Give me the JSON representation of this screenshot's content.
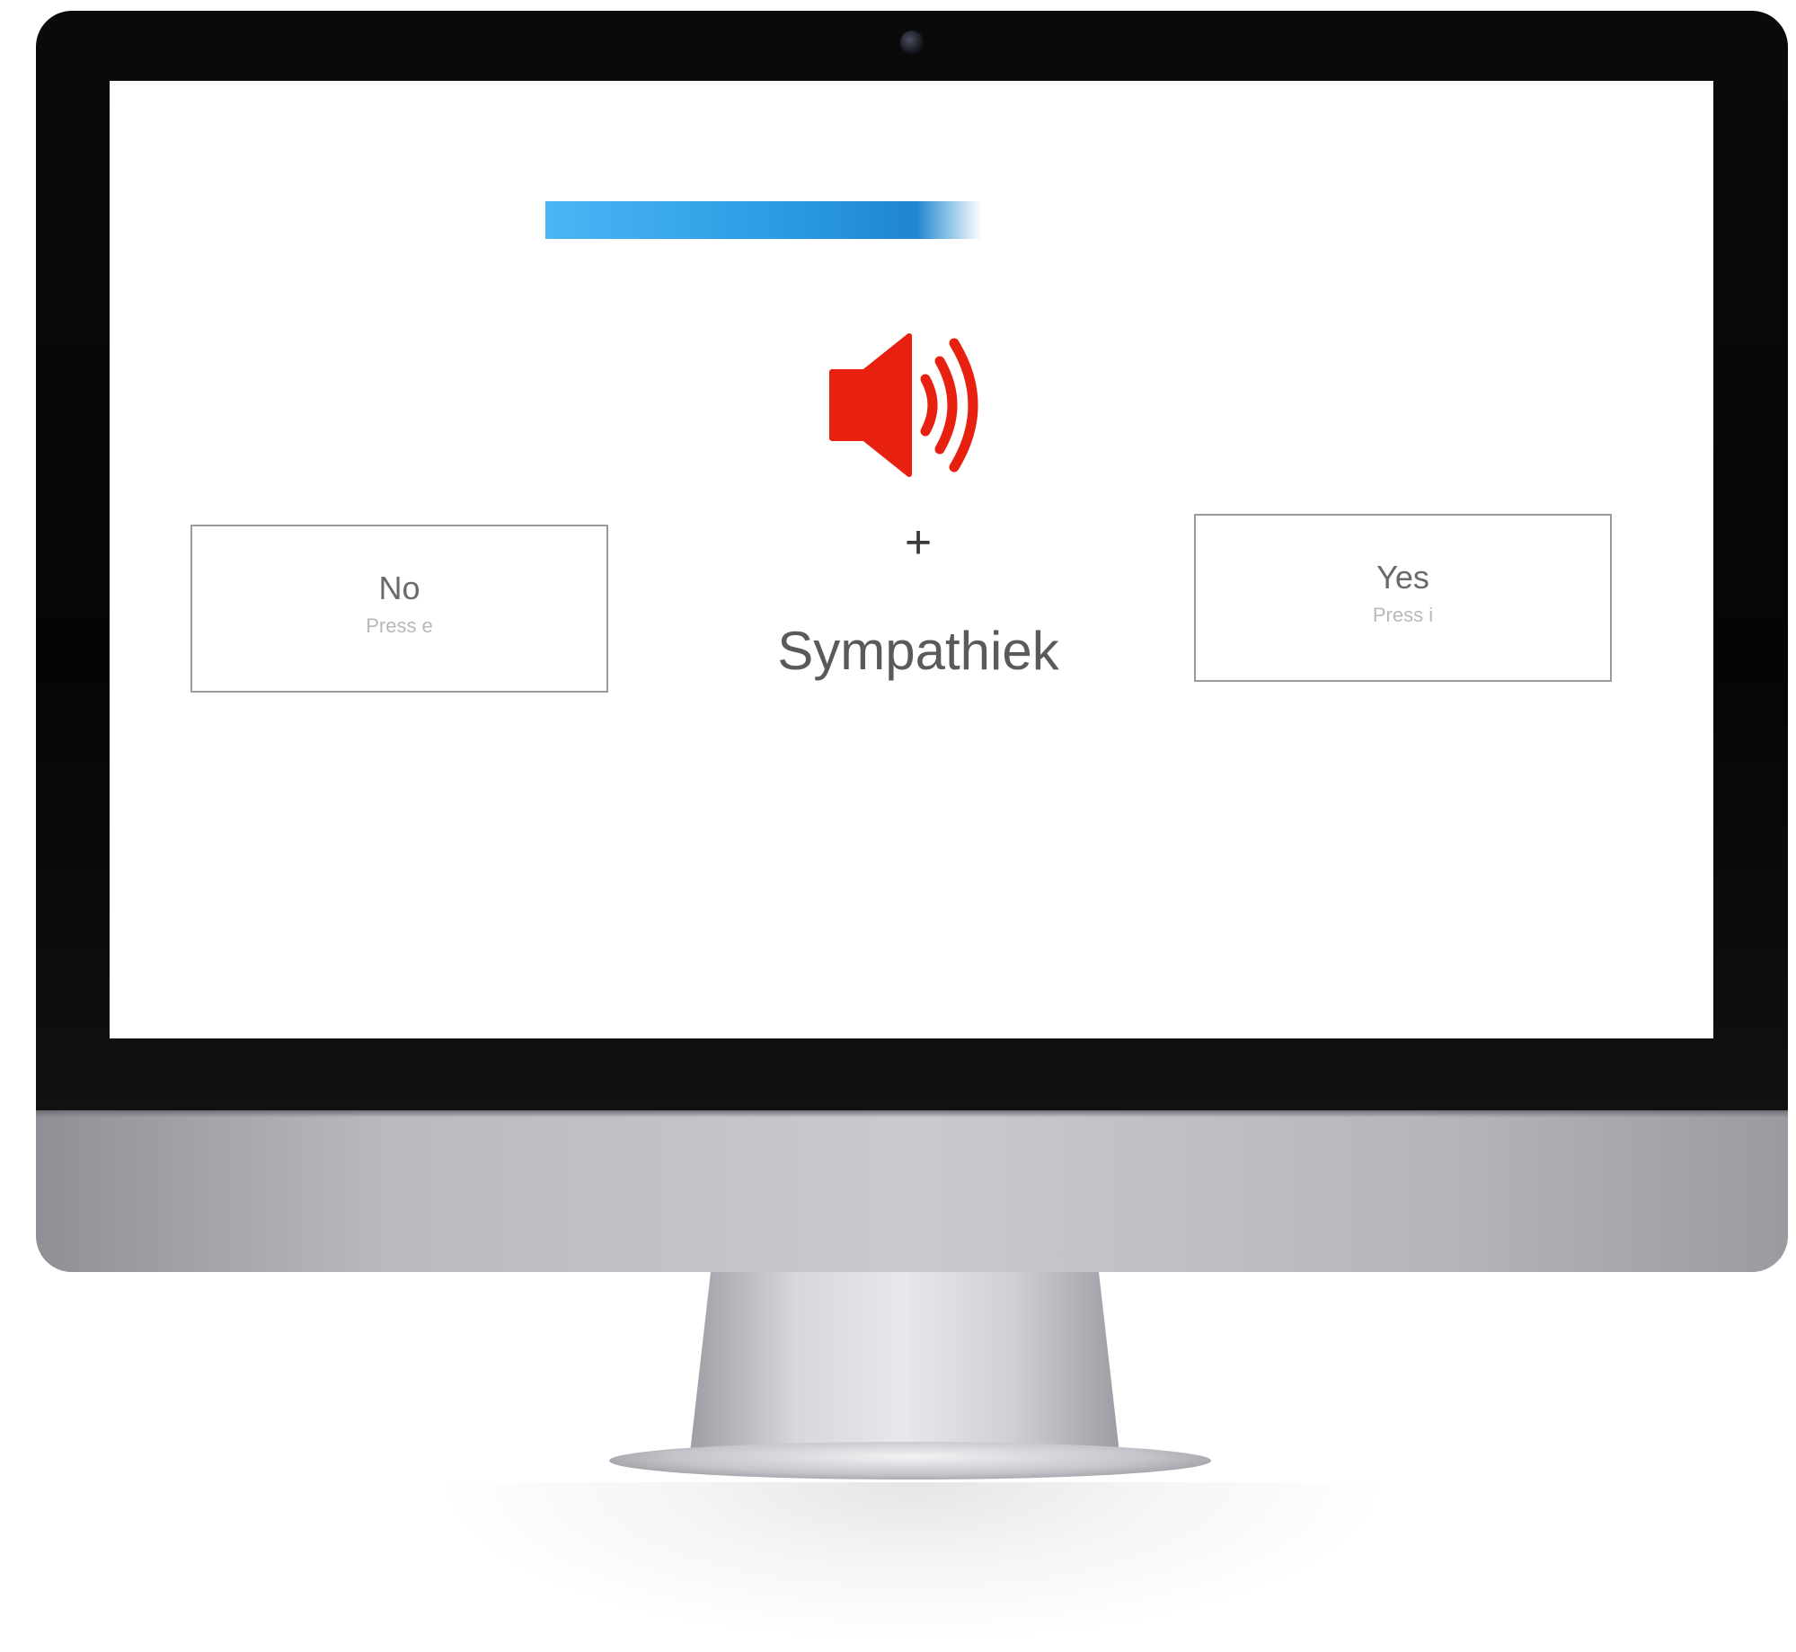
{
  "experiment": {
    "progress_fraction": 0.48,
    "stimulus_word": "Sympathiek",
    "fixation": "+",
    "audio_icon": "speaker-volume-icon"
  },
  "responses": {
    "no": {
      "label": "No",
      "hint": "Press e"
    },
    "yes": {
      "label": "Yes",
      "hint": "Press i"
    }
  },
  "colors": {
    "progress": "#2a9be3",
    "speaker": "#e8200f",
    "bezel": "#050505",
    "chin": "#c9cace"
  }
}
